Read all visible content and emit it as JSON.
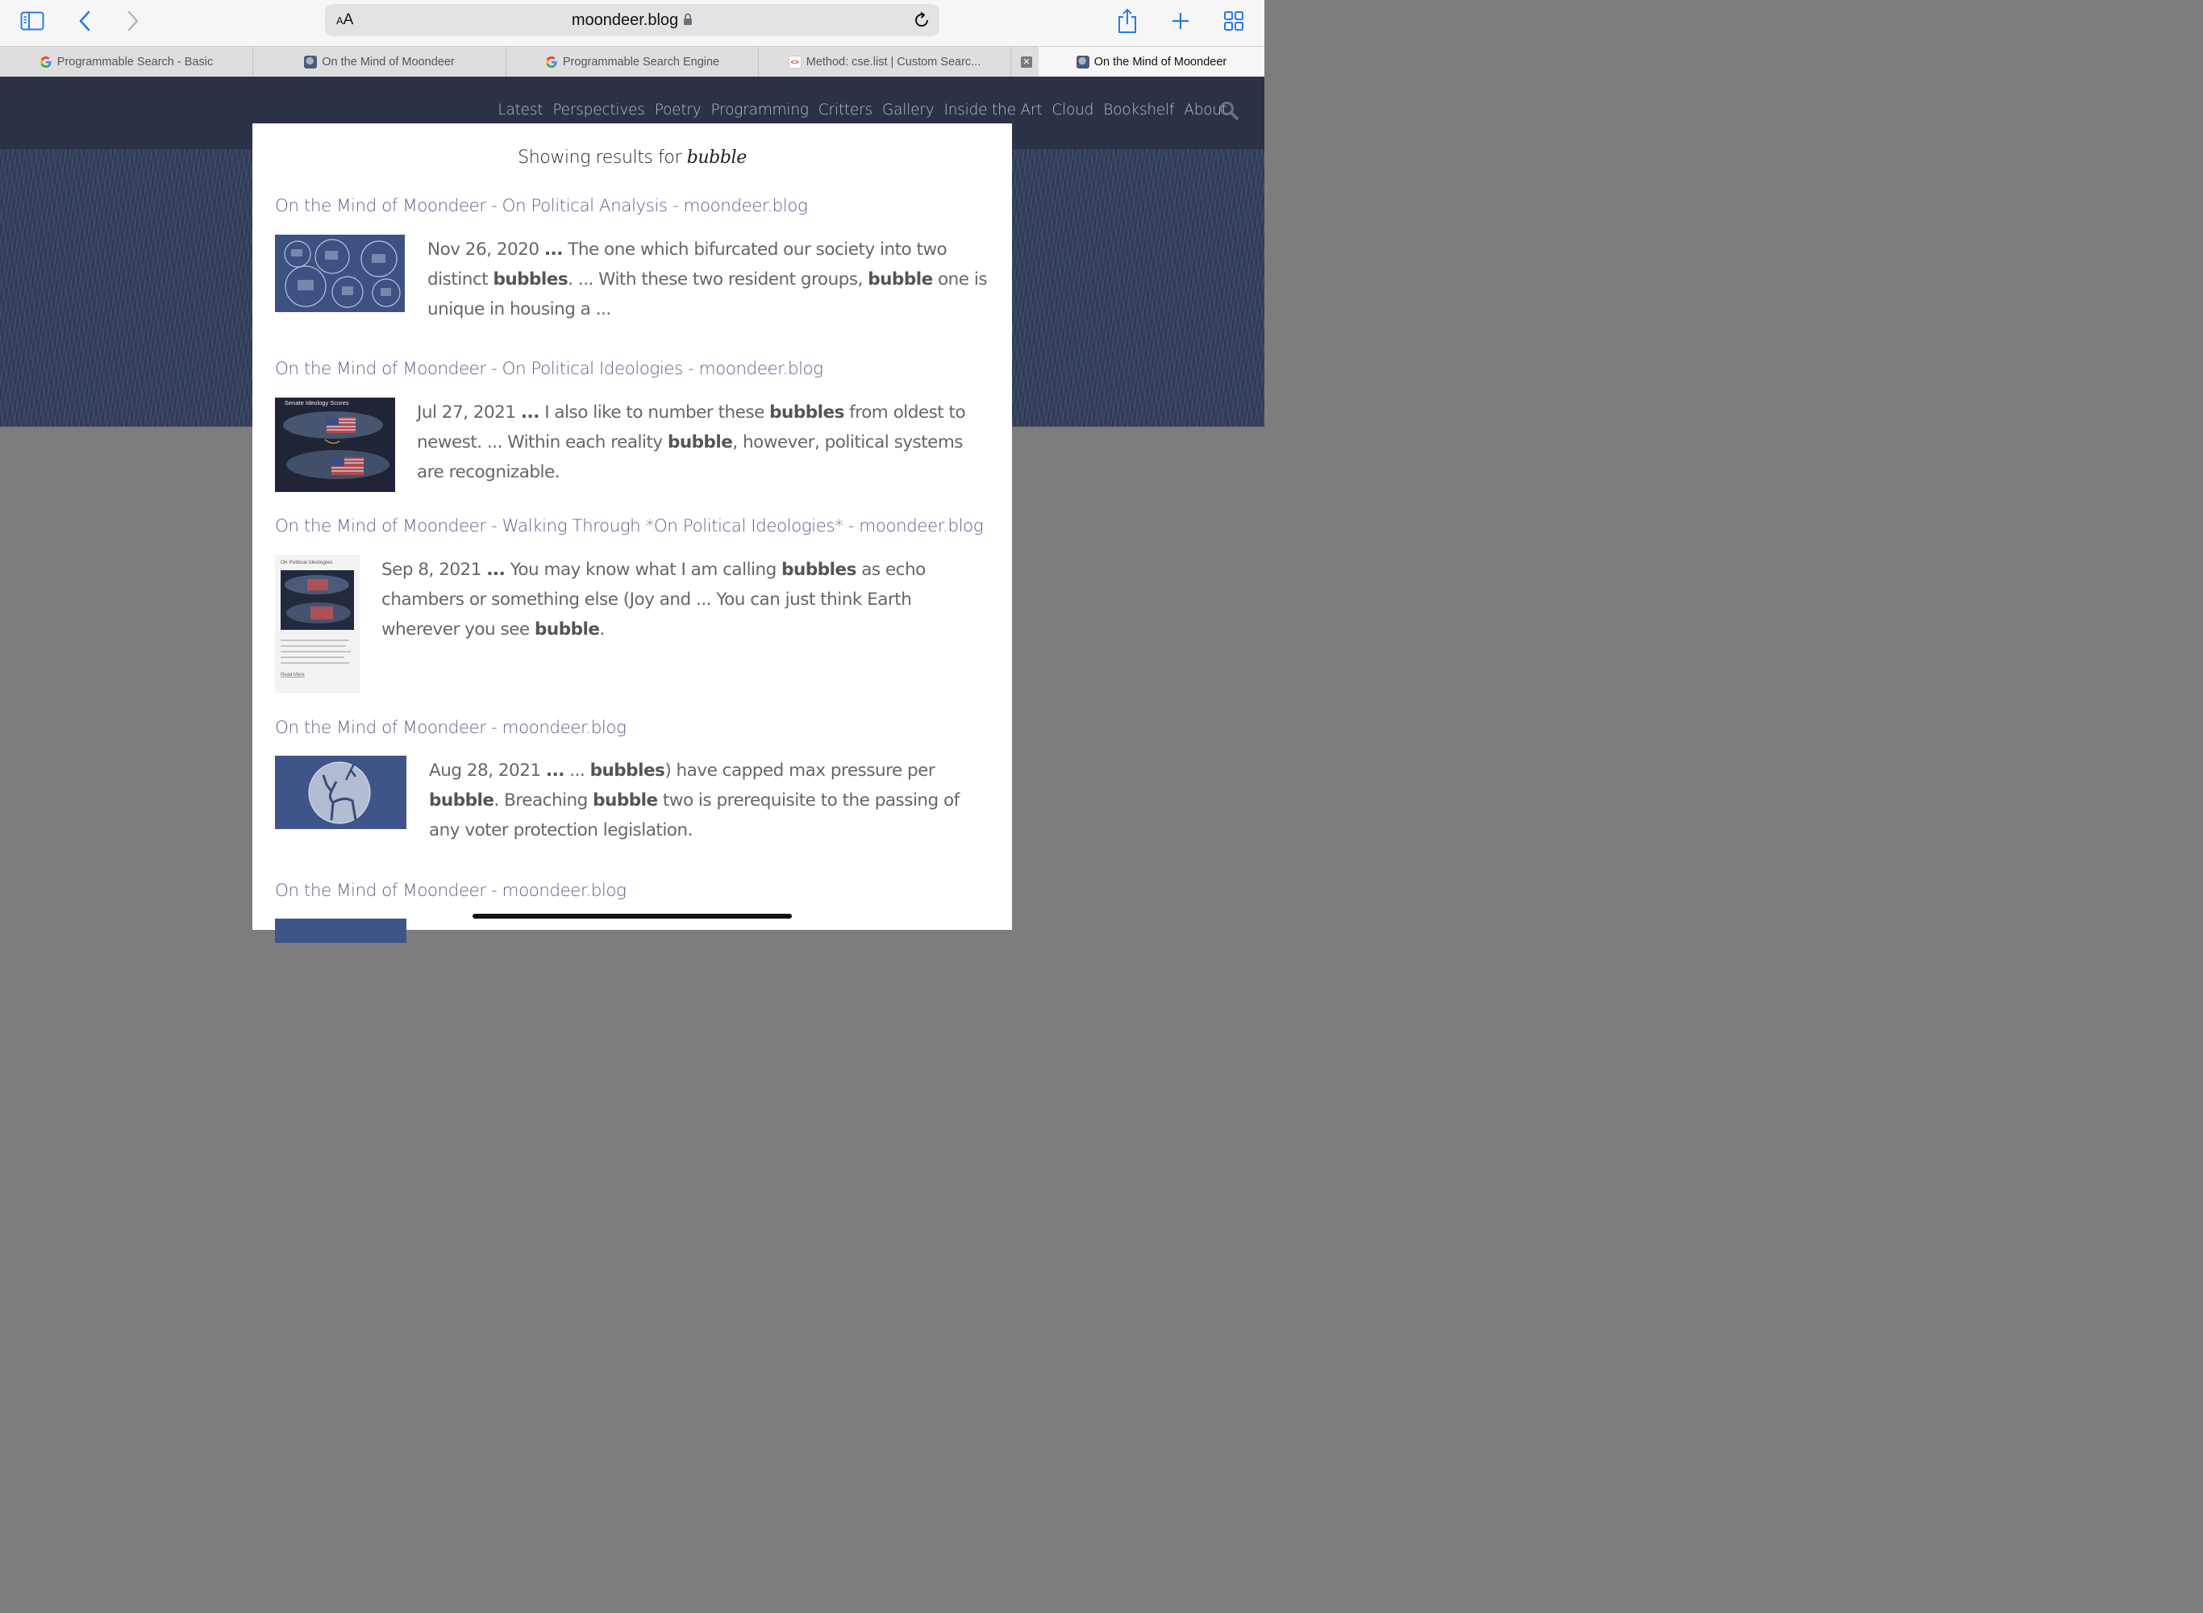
{
  "browser": {
    "aa_label": "AA",
    "url": "moondeer.blog",
    "tabs": [
      {
        "label": "Programmable Search - Basic",
        "favicon": "google-g-icon"
      },
      {
        "label": "On the Mind of Moondeer",
        "favicon": "moondeer-icon"
      },
      {
        "label": "Programmable Search Engine",
        "favicon": "google-g-icon"
      },
      {
        "label": "Method: cse.list  |  Custom Searc...",
        "favicon": "dev-docs-icon"
      },
      {
        "label": "On the Mind of Moondeer",
        "favicon": "moondeer-icon",
        "active": true
      }
    ]
  },
  "site": {
    "nav": [
      "Latest",
      "Perspectives",
      "Poetry",
      "Programming",
      "Critters",
      "Gallery",
      "Inside the Art",
      "Cloud",
      "Bookshelf",
      "About"
    ],
    "heading_prefix": "Showing results for ",
    "query": "bubble"
  },
  "results": [
    {
      "title": "On the Mind of Moondeer - On Political Analysis - moondeer.blog",
      "snippet": [
        {
          "t": "Nov 26, 2020 "
        },
        {
          "t": "...",
          "b": true
        },
        {
          "t": " The one which bifurcated our society into two distinct "
        },
        {
          "t": "bubbles",
          "b": true
        },
        {
          "t": ". ... With these two resident groups, "
        },
        {
          "t": "bubble",
          "b": true
        },
        {
          "t": " one is unique in housing a ..."
        }
      ]
    },
    {
      "title": "On the Mind of Moondeer - On Political Ideologies - moondeer.blog",
      "thumb_caption": "Senate Ideology Scores",
      "snippet": [
        {
          "t": "Jul 27, 2021 "
        },
        {
          "t": "...",
          "b": true
        },
        {
          "t": " I also like to number these "
        },
        {
          "t": "bubbles",
          "b": true
        },
        {
          "t": " from oldest to newest. ... Within each reality "
        },
        {
          "t": "bubble",
          "b": true
        },
        {
          "t": ", however, political systems are recognizable."
        }
      ]
    },
    {
      "title": "On the Mind of Moondeer - Walking Through *On Political Ideologies* - moondeer.blog",
      "thumb_caption": "On Political Ideologies",
      "thumb_link": "Read More",
      "snippet": [
        {
          "t": "Sep 8, 2021 "
        },
        {
          "t": "...",
          "b": true
        },
        {
          "t": " You may know what I am calling "
        },
        {
          "t": "bubbles",
          "b": true
        },
        {
          "t": " as echo chambers or something else (Joy and ... You can just think Earth wherever you see "
        },
        {
          "t": "bubble",
          "b": true
        },
        {
          "t": "."
        }
      ]
    },
    {
      "title": "On the Mind of Moondeer - moondeer.blog",
      "snippet": [
        {
          "t": "Aug 28, 2021 "
        },
        {
          "t": "...",
          "b": true
        },
        {
          "t": " ... "
        },
        {
          "t": "bubbles",
          "b": true
        },
        {
          "t": ") have capped max pressure per "
        },
        {
          "t": "bubble",
          "b": true
        },
        {
          "t": ". Breaching "
        },
        {
          "t": "bubble",
          "b": true
        },
        {
          "t": " two is prerequisite to the passing of any voter protection legislation."
        }
      ]
    },
    {
      "title": "On the Mind of Moondeer - moondeer.blog",
      "snippet": []
    }
  ]
}
